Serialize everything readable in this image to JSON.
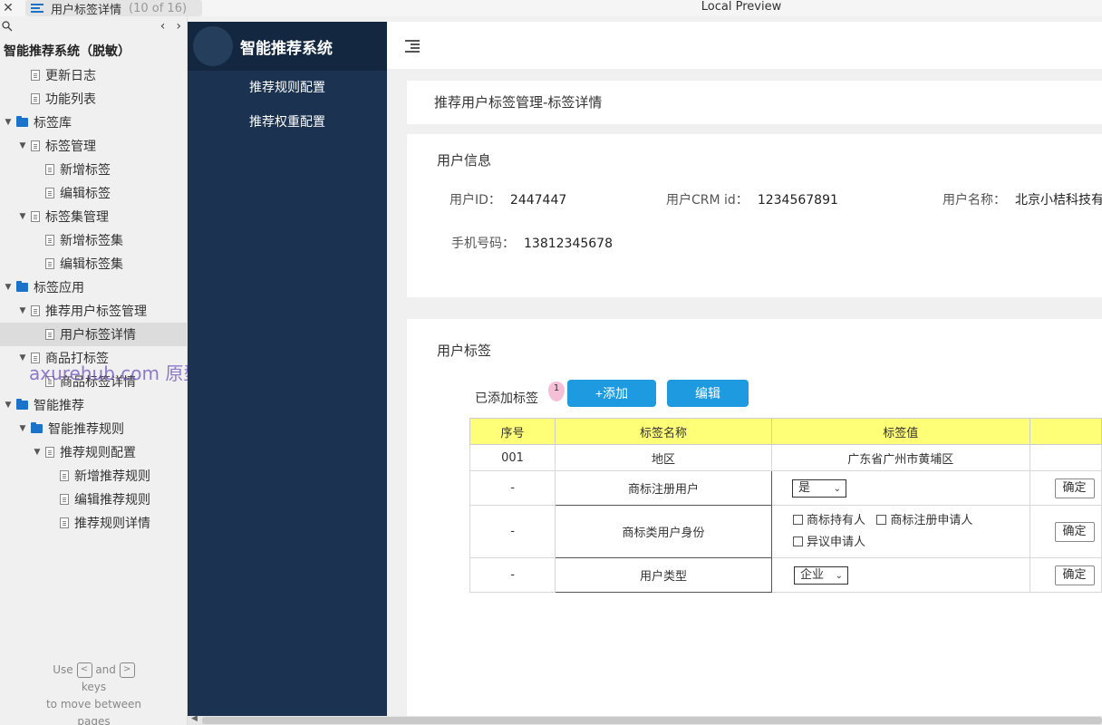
{
  "browser": {
    "close_glyph": "✕",
    "page_title": "用户标签详情",
    "page_counter": "(10 of 16)",
    "window_title": "Local Preview"
  },
  "nav": {
    "project_title": "智能推荐系统（脱敏）",
    "items": [
      {
        "label": "更新日志",
        "level": 1,
        "kind": "page"
      },
      {
        "label": "功能列表",
        "level": 1,
        "kind": "page"
      },
      {
        "label": "标签库",
        "level": 0,
        "kind": "folder",
        "expanded": true
      },
      {
        "label": "标签管理",
        "level": 1,
        "kind": "page",
        "expanded": true
      },
      {
        "label": "新增标签",
        "level": 2,
        "kind": "page"
      },
      {
        "label": "编辑标签",
        "level": 2,
        "kind": "page"
      },
      {
        "label": "标签集管理",
        "level": 1,
        "kind": "page",
        "expanded": true
      },
      {
        "label": "新增标签集",
        "level": 2,
        "kind": "page"
      },
      {
        "label": "编辑标签集",
        "level": 2,
        "kind": "page"
      },
      {
        "label": "标签应用",
        "level": 0,
        "kind": "folder",
        "expanded": true
      },
      {
        "label": "推荐用户标签管理",
        "level": 1,
        "kind": "page",
        "expanded": true
      },
      {
        "label": "用户标签详情",
        "level": 2,
        "kind": "page",
        "selected": true
      },
      {
        "label": "商品打标签",
        "level": 1,
        "kind": "page",
        "expanded": true
      },
      {
        "label": "商品标签详情",
        "level": 2,
        "kind": "page"
      },
      {
        "label": "智能推荐",
        "level": 0,
        "kind": "folder",
        "expanded": true
      },
      {
        "label": "智能推荐规则",
        "level": 1,
        "kind": "folder",
        "expanded": true
      },
      {
        "label": "推荐规则配置",
        "level": 2,
        "kind": "page",
        "expanded": true
      },
      {
        "label": "新增推荐规则",
        "level": 3,
        "kind": "page"
      },
      {
        "label": "编辑推荐规则",
        "level": 3,
        "kind": "page"
      },
      {
        "label": "推荐规则详情",
        "level": 3,
        "kind": "page"
      }
    ],
    "watermark": "axurehub.com 原型资源站",
    "hint": {
      "use": "Use",
      "and": "and",
      "keys": "keys",
      "line2": "to move between",
      "line3": "pages",
      "prev_key": "<",
      "next_key": ">"
    }
  },
  "app": {
    "brand_name": "智能推荐系统",
    "menu": [
      "推荐规则配置",
      "推荐权重配置"
    ]
  },
  "main": {
    "breadcrumb": "推荐用户标签管理-标签详情",
    "user_info": {
      "title": "用户信息",
      "fields": [
        {
          "label": "用户ID：",
          "value": "2447447"
        },
        {
          "label": "用户CRM id：",
          "value": "1234567891"
        },
        {
          "label": "用户名称：",
          "value": "北京小桔科技有"
        },
        {
          "label": "手机号码：",
          "value": "13812345678"
        }
      ]
    },
    "user_tags": {
      "title": "用户标签",
      "added_label": "已添加标签",
      "badge": "1",
      "add_button": "+添加",
      "edit_button": "编辑",
      "columns": [
        "序号",
        "标签名称",
        "标签值",
        ""
      ],
      "rows": [
        {
          "index": "001",
          "name": "地区",
          "value_text": "广东省广州市黄埔区"
        },
        {
          "index": "-",
          "name": "商标注册用户",
          "select": "是",
          "action": "确定"
        },
        {
          "index": "-",
          "name": "商标类用户身份",
          "checkboxes": [
            "商标持有人",
            "商标注册申请人",
            "异议申请人"
          ],
          "action": "确定"
        },
        {
          "index": "-",
          "name": "用户类型",
          "select": "企业",
          "action": "确定"
        }
      ]
    }
  },
  "colors": {
    "app_sidebar": "#1b3350",
    "brand_bar": "#132840",
    "primary_button": "#1e9ae0",
    "table_header": "#ffff77",
    "nav_folder": "#1a73c9",
    "badge": "#f6bfd8"
  }
}
